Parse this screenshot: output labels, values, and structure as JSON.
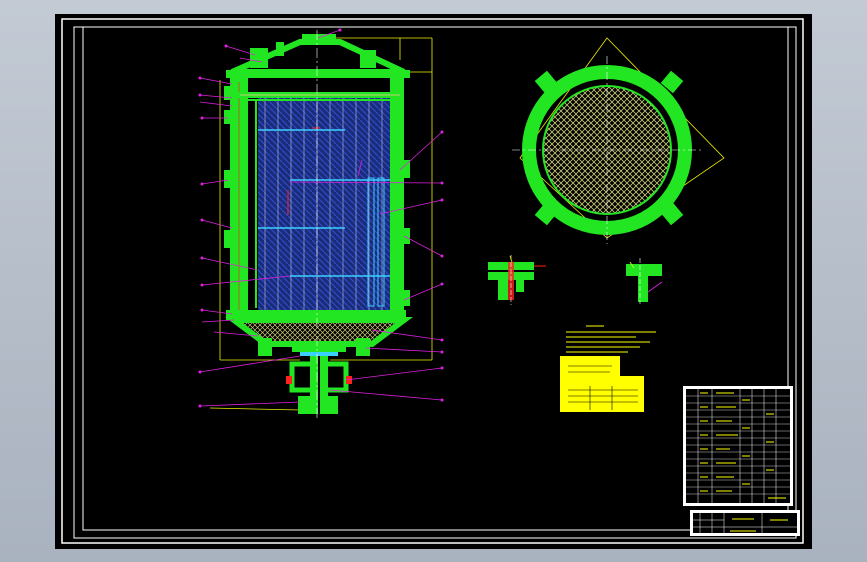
{
  "colors": {
    "background": "#b4bcc8",
    "sheet": "#000000",
    "frame": "#ffffff",
    "vessel": "#22e622",
    "hatch": "#1a2c7a",
    "hatch_line": "#2f4fd0",
    "leader": "#e020e0",
    "dimension": "#f0f000",
    "filler_mesh": "#c8c87a",
    "pipe_blue": "#3ad0ff",
    "red_mark": "#ff2020",
    "note_yellow": "#ffff00",
    "white": "#ffffff"
  },
  "icons": {
    "main_vessel": "vertical-pressure-vessel-section",
    "plan_view": "tube-sheet-plan-view",
    "detail_a": "flange-nozzle-detail",
    "detail_b": "t-support-detail",
    "title_block": "drawing-title-block",
    "parts_list": "bill-of-materials-table"
  }
}
